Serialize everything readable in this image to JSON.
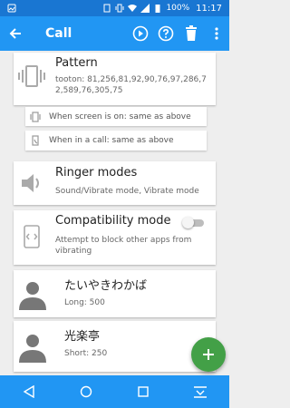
{
  "status": {
    "battery": "100%",
    "time": "11:17"
  },
  "appbar": {
    "title": "Call"
  },
  "pattern": {
    "title": "Pattern",
    "value": "tooton: 81,256,81,92,90,76,97,286,72,589,76,305,75"
  },
  "screen_on": {
    "label": "When screen is on: same as above"
  },
  "in_call": {
    "label": "When in a call: same as above"
  },
  "ringer": {
    "title": "Ringer modes",
    "value": "Sound/Vibrate mode, Vibrate mode"
  },
  "compat": {
    "title": "Compatibility mode",
    "desc": "Attempt to block other apps from vibrating",
    "enabled": false
  },
  "contacts": [
    {
      "name": "たいやきわかば",
      "detail": "Long: 500"
    },
    {
      "name": "光楽亭",
      "detail": "Short: 250"
    }
  ],
  "colors": {
    "primary": "#2196f3",
    "status": "#1976d2",
    "fab": "#43a047"
  }
}
